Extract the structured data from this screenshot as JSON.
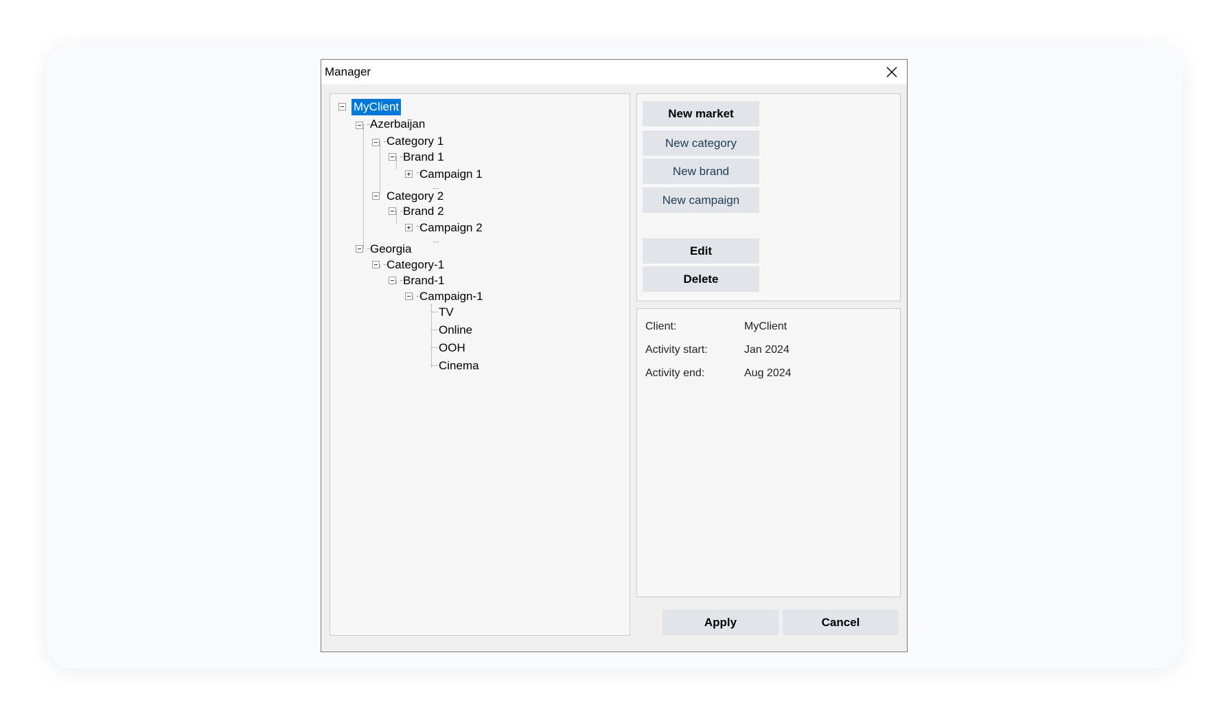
{
  "window": {
    "title": "Manager"
  },
  "tree": {
    "root": "MyClient",
    "azerbaijan": "Azerbaijan",
    "category1": "Category 1",
    "brand1": "Brand 1",
    "campaign1": "Campaign 1",
    "category2": "Category 2",
    "brand2": "Brand 2",
    "campaign2": "Campaign 2",
    "georgia": "Georgia",
    "category_1": "Category-1",
    "brand_1": "Brand-1",
    "campaign_1": "Campaign-1",
    "tv": "TV",
    "online": "Online",
    "ooh": "OOH",
    "cinema": "Cinema"
  },
  "actions": {
    "new_market": "New market",
    "new_category": "New category",
    "new_brand": "New brand",
    "new_campaign": "New campaign",
    "edit": "Edit",
    "delete": "Delete"
  },
  "info": {
    "client_label": "Client:",
    "client_value": "MyClient",
    "start_label": "Activity start:",
    "start_value": "Jan 2024",
    "end_label": "Activity end:",
    "end_value": "Aug 2024"
  },
  "footer": {
    "apply": "Apply",
    "cancel": "Cancel"
  },
  "icons": {
    "close": "close-icon",
    "expand": "plus-box-icon",
    "collapse": "minus-box-icon"
  },
  "colors": {
    "selection": "#0078d7",
    "button": "#e1e5ea",
    "panel": "#f7f7f7"
  }
}
